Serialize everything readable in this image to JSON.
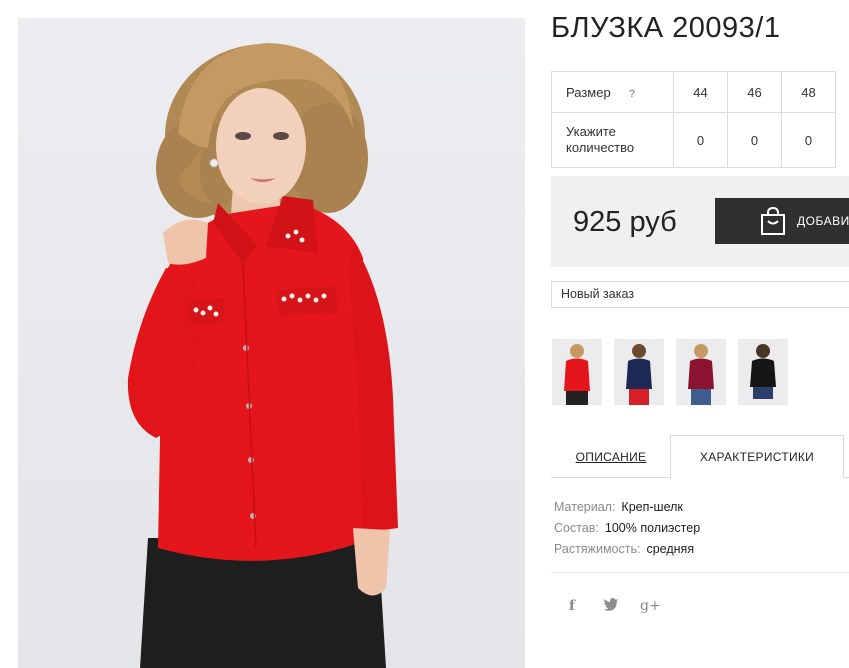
{
  "product": {
    "title": "БЛУЗКА 20093/1",
    "image_alt": "red blouse main photo"
  },
  "sizes": {
    "size_label": "Размер",
    "help_label": "?",
    "qty_label": "Укажите количество",
    "options": [
      {
        "size": "44",
        "qty": "0"
      },
      {
        "size": "46",
        "qty": "0"
      },
      {
        "size": "48",
        "qty": "0"
      }
    ]
  },
  "price": {
    "value": "925 руб",
    "add_button_label": "ДОБАВИ"
  },
  "order": {
    "selected": "Новый заказ"
  },
  "thumbnails": [
    {
      "color": "red",
      "name": "thumb-red"
    },
    {
      "color": "navy",
      "name": "thumb-navy"
    },
    {
      "color": "burgundy",
      "name": "thumb-burgundy"
    },
    {
      "color": "black",
      "name": "thumb-black"
    }
  ],
  "tabs": {
    "description": "ОПИСАНИЕ",
    "characteristics": "ХАРАКТЕРИСТИКИ"
  },
  "specs": [
    {
      "key": "Материал:",
      "value": "Креп-шелк"
    },
    {
      "key": "Состав:",
      "value": "100% полиэстер"
    },
    {
      "key": "Растяжимость:",
      "value": "средняя"
    }
  ],
  "social": {
    "facebook": "f",
    "twitter": "t",
    "googleplus": "g+"
  },
  "colors": {
    "blouse": "#e5161b",
    "button_bg": "#2f2f2f",
    "price_bg": "#f0f0f0"
  }
}
